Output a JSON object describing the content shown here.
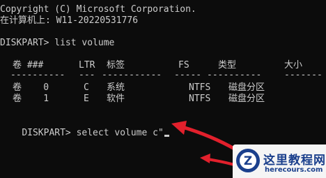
{
  "console": {
    "copyright_line": "Copyright (C) Microsoft Corporation.",
    "host_line": "在计算机上: W11-20220531776",
    "prompt1": "DISKPART> list volume",
    "table": {
      "headers": [
        "卷 ###",
        "LTR",
        "标签",
        "FS",
        "类型",
        "大小"
      ],
      "separators": [
        "----------",
        "---",
        "-----------",
        "-----",
        "----------",
        "-------"
      ],
      "rows": [
        [
          "卷    0",
          "C",
          "系统",
          "NTFS",
          "磁盘分区"
        ],
        [
          "卷    1",
          "E",
          "软件",
          "NTFS",
          "磁盘分区"
        ]
      ]
    },
    "prompt2": "DISKPART> select volume c\""
  },
  "watermark": {
    "title": "这里教程网",
    "url": "herecours.com",
    "logo_letter": "Z"
  },
  "colors": {
    "background": "#0c0c0c",
    "text": "#cccccc",
    "arrow": "#e2202c",
    "watermark_blue": "#1a3f8c"
  }
}
